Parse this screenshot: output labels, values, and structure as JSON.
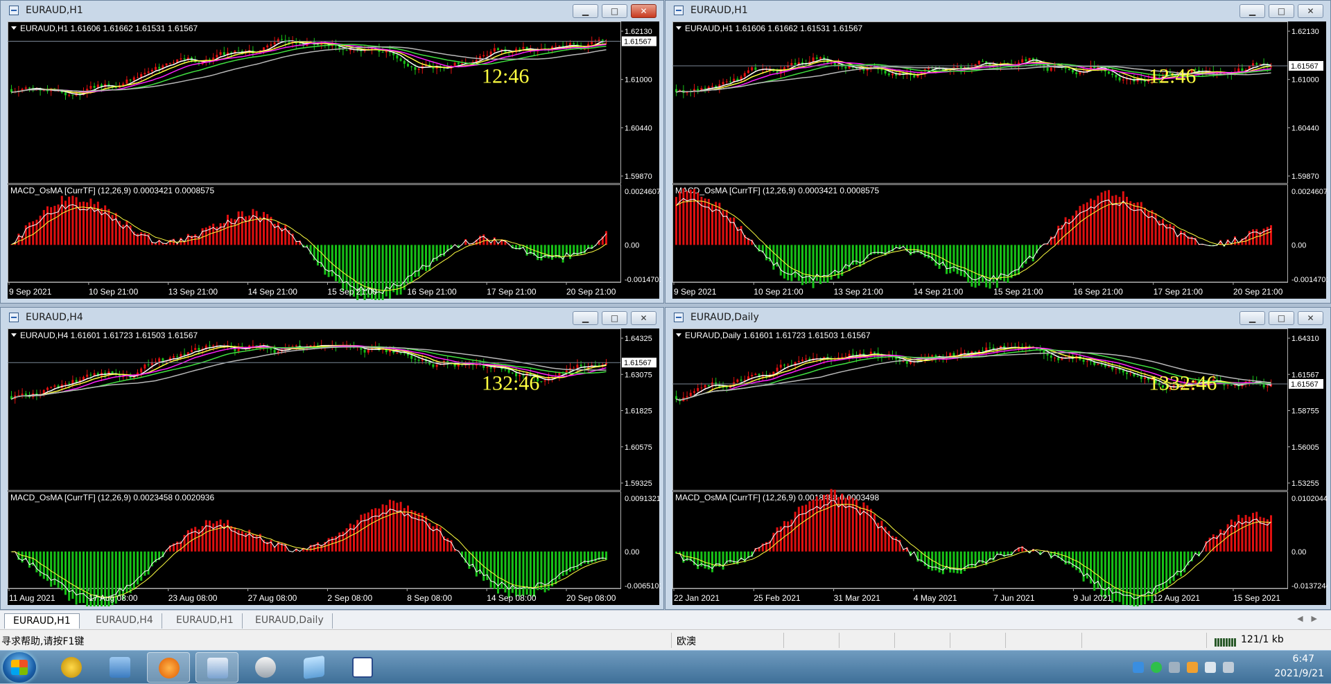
{
  "windows": [
    {
      "title": "EURAUD,H1",
      "header": "EURAUD,H1  1.61606 1.61662 1.61531 1.61567",
      "timer": "12:46",
      "price_ticks": [
        "1.62130",
        "1.61000",
        "1.60440",
        "1.59870"
      ],
      "current_price": "1.61567",
      "macd_label": "MACD_OsMA [CurrTF] (12,26,9) 0.0003421 0.0008575",
      "macd_ticks": [
        "0.0024607",
        "0.00",
        "-0.0014701"
      ],
      "time_labels": [
        "9 Sep 2021",
        "10 Sep 21:00",
        "13 Sep 21:00",
        "14 Sep 21:00",
        "15 Sep 21:00",
        "16 Sep 21:00",
        "17 Sep 21:00",
        "20 Sep 21:00"
      ],
      "close_active": true
    },
    {
      "title": "EURAUD,H1",
      "header": "EURAUD,H1  1.61606 1.61662 1.61531 1.61567",
      "timer": "12:46",
      "price_ticks": [
        "1.62130",
        "1.61000",
        "1.60440",
        "1.59870"
      ],
      "current_price": "1.61567",
      "macd_label": "MACD_OsMA [CurrTF] (12,26,9) 0.0003421 0.0008575",
      "macd_ticks": [
        "0.0024607",
        "0.00",
        "-0.0014701"
      ],
      "time_labels": [
        "9 Sep 2021",
        "10 Sep 21:00",
        "13 Sep 21:00",
        "14 Sep 21:00",
        "15 Sep 21:00",
        "16 Sep 21:00",
        "17 Sep 21:00",
        "20 Sep 21:00"
      ],
      "close_active": false
    },
    {
      "title": "EURAUD,H4",
      "header": "EURAUD,H4  1.61601 1.61723 1.61503 1.61567",
      "timer": "132:46",
      "price_ticks": [
        "1.64325",
        "1.63075",
        "1.61825",
        "1.60575",
        "1.59325"
      ],
      "current_price": "1.61567",
      "macd_label": "MACD_OsMA [CurrTF] (12,26,9) 0.0023458 0.0020936",
      "macd_ticks": [
        "0.0091321",
        "0.00",
        "-0.0065101"
      ],
      "time_labels": [
        "11 Aug 2021",
        "17 Aug 08:00",
        "23 Aug 08:00",
        "27 Aug 08:00",
        "2 Sep 08:00",
        "8 Sep 08:00",
        "14 Sep 08:00",
        "20 Sep 08:00"
      ],
      "close_active": false
    },
    {
      "title": "EURAUD,Daily",
      "header": "EURAUD,Daily  1.61601 1.61723 1.61503 1.61567",
      "timer": "1332:46",
      "price_ticks": [
        "1.64310",
        "1.61567",
        "1.58755",
        "1.56005",
        "1.53255"
      ],
      "current_price": "1.61567",
      "macd_label": "MACD_OsMA [CurrTF] (12,26,9) 0.0018488 0.0003498",
      "macd_ticks": [
        "0.0102044",
        "0.00",
        "-0.0137244"
      ],
      "time_labels": [
        "22 Jan 2021",
        "25 Feb 2021",
        "31 Mar 2021",
        "4 May 2021",
        "7 Jun 2021",
        "9 Jul 2021",
        "12 Aug 2021",
        "15 Sep 2021"
      ],
      "close_active": false
    }
  ],
  "tabs": [
    "EURAUD,H1",
    "EURAUD,H4",
    "EURAUD,H1",
    "EURAUD,Daily"
  ],
  "status": {
    "help": "寻求帮助,请按F1键",
    "profile": "欧澳",
    "traffic": "121/1 kb"
  },
  "clock": {
    "time": "6:47",
    "date": "2021/9/21"
  },
  "window_controls": {
    "minimize": "▁",
    "restore": "□",
    "close": "✕"
  },
  "colors": {
    "candle_up": "#17c217",
    "candle_down": "#e01010",
    "ma_white": "#ffffff",
    "ma_yellow": "#ffff40",
    "ma_magenta": "#ff20ff",
    "ma_green": "#40e040",
    "ma_gray": "#b8b8b8",
    "timer": "#ffff40"
  }
}
